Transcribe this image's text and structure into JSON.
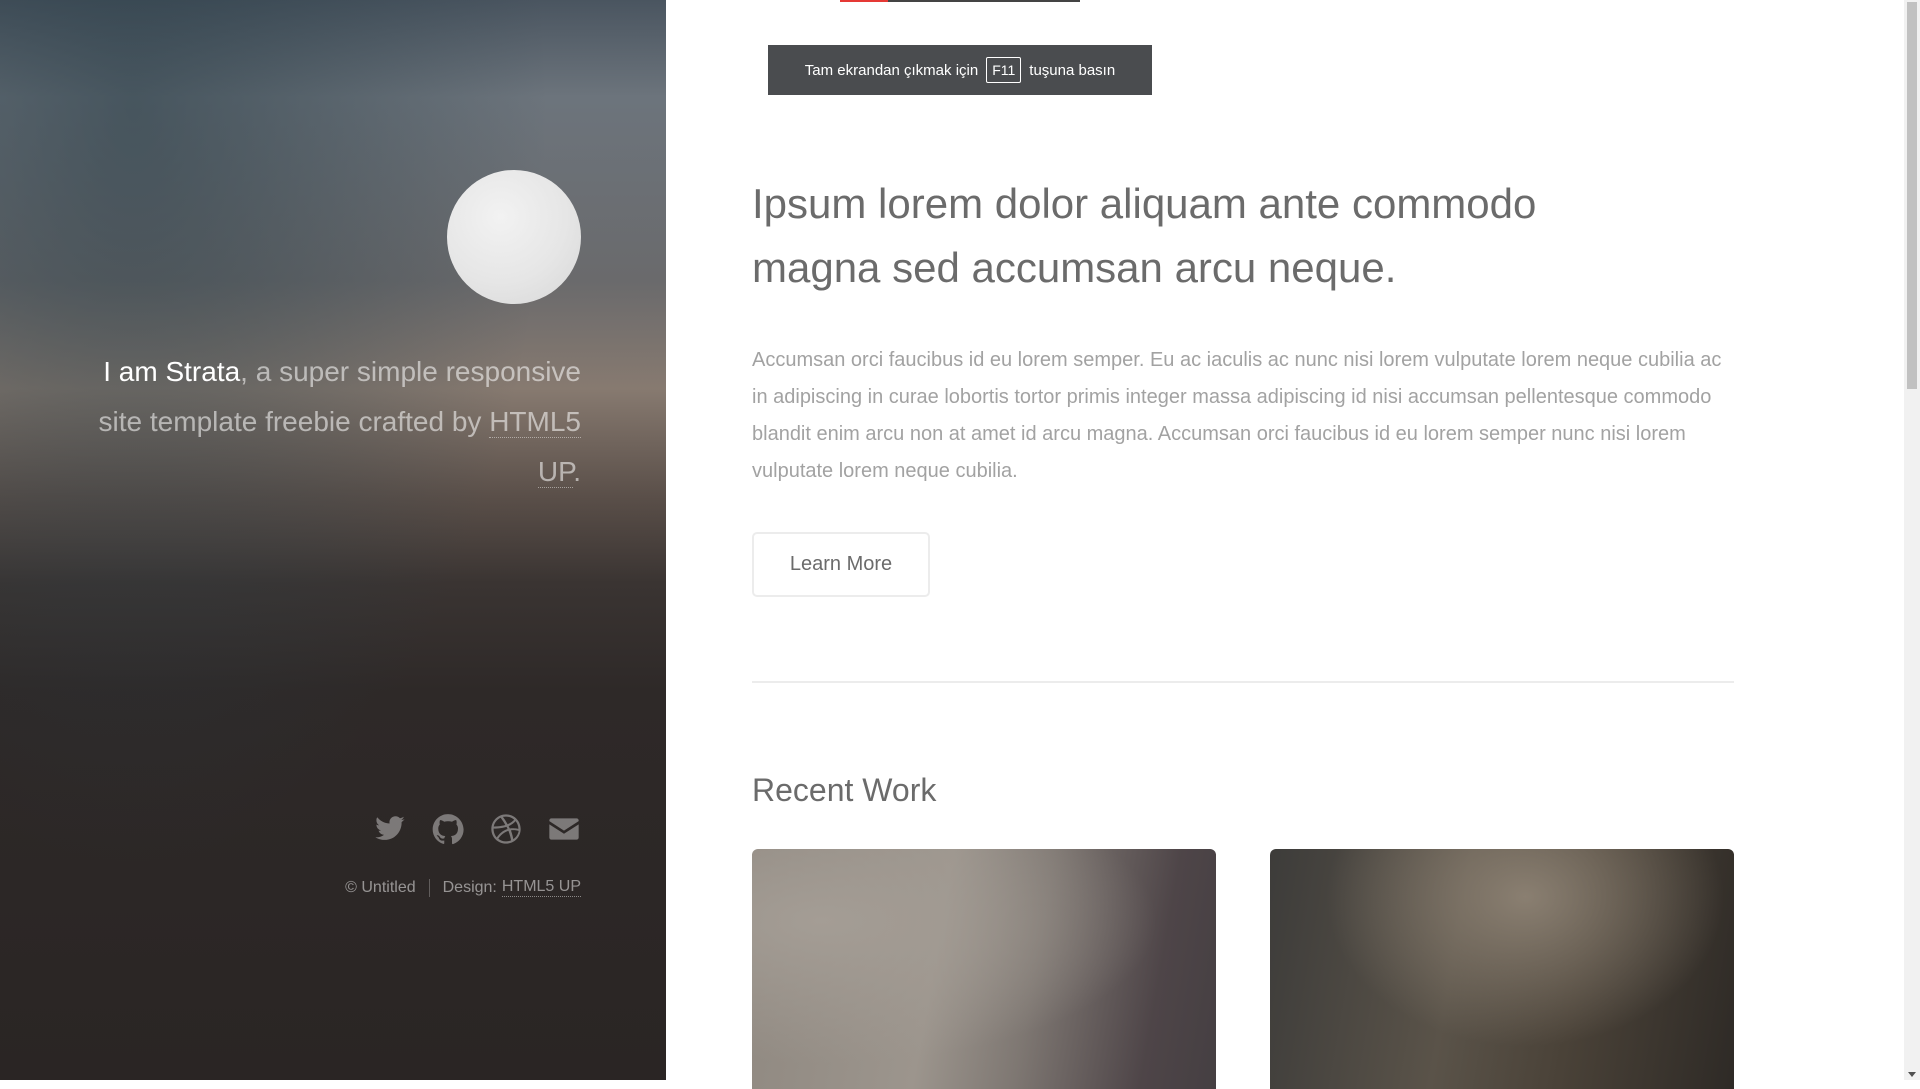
{
  "sidebar": {
    "intro": {
      "name": "I am Strata",
      "comma": ",",
      "text_part1": " a super simple responsive site template freebie crafted by ",
      "link": "HTML5 UP",
      "period": "."
    },
    "social": [
      {
        "name": "twitter-icon"
      },
      {
        "name": "github-icon"
      },
      {
        "name": "dribbble-icon"
      },
      {
        "name": "envelope-icon"
      }
    ],
    "footer": {
      "copyright": "© Untitled",
      "design_label": "Design:",
      "design_link": "HTML5 UP"
    }
  },
  "fullscreen_banner": {
    "before": "Tam ekrandan çıkmak için",
    "key": "F11",
    "after": "tuşuna basın"
  },
  "main": {
    "headline": "Ipsum lorem dolor aliquam ante commodo magna sed accumsan arcu neque.",
    "lead": "Accumsan orci faucibus id eu lorem semper. Eu ac iaculis ac nunc nisi lorem vulputate lorem neque cubilia ac in adipiscing in curae lobortis tortor primis integer massa adipiscing id nisi accumsan pellentesque commodo blandit enim arcu non at amet id arcu magna. Accumsan orci faucibus id eu lorem semper nunc nisi lorem vulputate lorem neque cubilia.",
    "learn_more_label": "Learn More",
    "recent_work_title": "Recent Work"
  },
  "colors": {
    "accent_tab": "#e53935",
    "banner_bg": "#4a4c4f",
    "heading_text": "#6b6b6b",
    "body_text": "#a2a2a2"
  }
}
